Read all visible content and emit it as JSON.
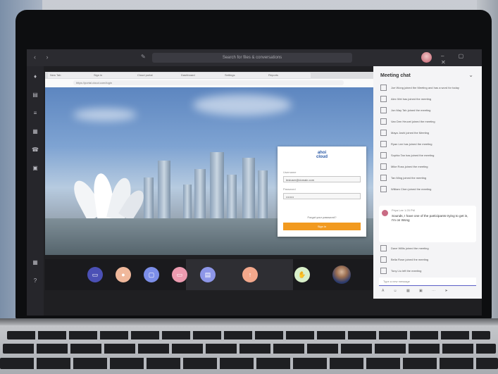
{
  "window": {
    "search_placeholder": "Search for files & conversations"
  },
  "rail": {
    "icons": [
      "activity-icon",
      "chat-icon",
      "teams-icon",
      "calendar-icon",
      "calls-icon",
      "files-icon"
    ]
  },
  "browser": {
    "tabs": [
      "New Tab",
      "Sign in",
      "Cloud portal",
      "Dashboard",
      "Settings",
      "Reports"
    ],
    "address": "https://portal.cloud.com/login"
  },
  "login": {
    "logo_line1": "ahoi",
    "logo_line2": "cloud",
    "username_label": "Username",
    "username_value": "testuser@domain.com",
    "password_label": "Password",
    "password_value": "••••••••",
    "forgot_link": "Forgot your password?",
    "signin_button": "Sign in"
  },
  "call": {
    "buttons": [
      "video-icon",
      "mic-icon",
      "share-icon",
      "more-icon",
      "chat-toggle-icon"
    ]
  },
  "chat": {
    "title": "Meeting chat",
    "items": [
      "Joe Wong joined the Meeting and has a word for today",
      "Alex Wei has joined the meeting",
      "Jon May Tah joined the meeting",
      "Van Den Heuvel joined the meeting",
      "Maya Joshi joined the Meeting",
      "Ryan Lee has joined the meeting",
      "Sophia Tan has joined the meeting",
      "Mike Ross joined the meeting",
      "Tan Ming joined the meeting",
      "William Chen joined the meeting"
    ],
    "message": {
      "author": "Priya Lee  1:25 PM",
      "text": "Sounds, I have one of the participants trying to get in, I'm on Wong"
    },
    "items_after": [
      "Dave Willis joined the meeting",
      "Bella Rose joined the meeting",
      "Tony Liu left the meeting"
    ],
    "input_placeholder": "Type a new message"
  }
}
